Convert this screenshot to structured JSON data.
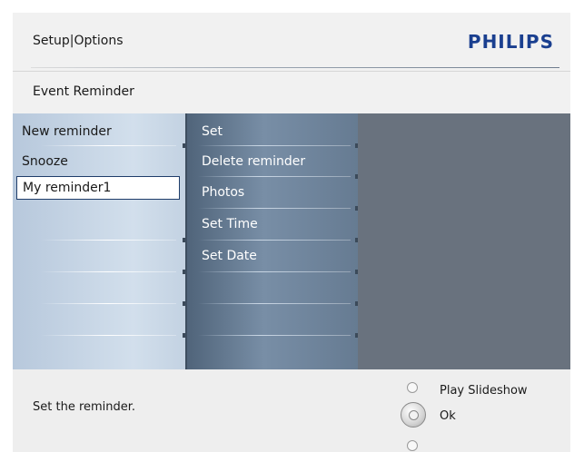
{
  "header": {
    "title": "Setup|Options",
    "brand": "PHILIPS",
    "brand_color": "#1a3f8f"
  },
  "sub_header": {
    "title": "Event Reminder"
  },
  "menu_col1": {
    "items": [
      {
        "label": "New reminder"
      },
      {
        "label": "Snooze"
      },
      {
        "label": "My reminder1",
        "selected": true
      }
    ]
  },
  "menu_col2": {
    "items": [
      {
        "label": "Set"
      },
      {
        "label": "Delete reminder"
      },
      {
        "label": "Photos"
      },
      {
        "label": "Set Time"
      },
      {
        "label": "Set Date"
      }
    ]
  },
  "footer": {
    "hint": "Set the reminder.",
    "controls": {
      "up_label": "Play Slideshow",
      "ok_label": "Ok"
    }
  }
}
